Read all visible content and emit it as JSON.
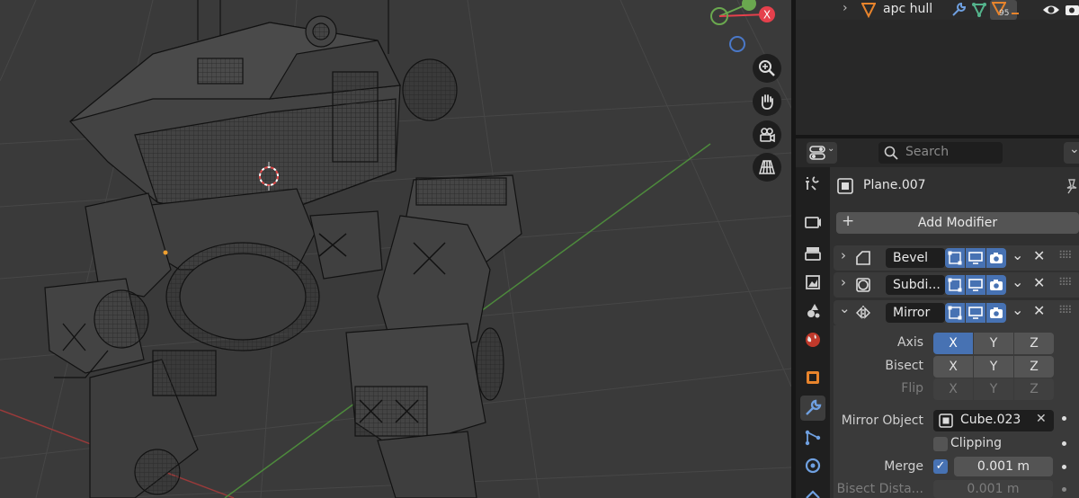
{
  "outliner": {
    "item_label": "apc hull",
    "badge_count": "95"
  },
  "properties": {
    "search_placeholder": "Search",
    "object_name": "Plane.007",
    "add_modifier_label": "Add Modifier",
    "modifiers": [
      {
        "name": "Bevel",
        "expanded": false
      },
      {
        "name": "Subdi...",
        "expanded": false
      },
      {
        "name": "Mirror",
        "expanded": true
      }
    ],
    "mirror": {
      "axis_label": "Axis",
      "bisect_label": "Bisect",
      "flip_label": "Flip",
      "axes": [
        "X",
        "Y",
        "Z"
      ],
      "mirror_object_label": "Mirror Object",
      "mirror_object_value": "Cube.023",
      "clipping_label": "Clipping",
      "merge_label": "Merge",
      "merge_value": "0.001 m",
      "bisect_distance_label": "Bisect Dista...",
      "bisect_distance_value": "0.001 m"
    }
  },
  "colors": {
    "accent": "#4772b3",
    "viewport_bg": "#3a3a3a",
    "panel_bg": "#303030",
    "axis_x": "#e5404c",
    "axis_y": "#6aa84f",
    "axis_z": "#4a78c8"
  },
  "icons": {
    "nav": [
      "zoom-icon",
      "hand-pan-icon",
      "camera-view-icon",
      "grid-perspective-icon"
    ],
    "tabs": [
      "tool-icon",
      "render-icon",
      "output-icon",
      "view-layer-icon",
      "scene-icon",
      "world-icon",
      "object-icon",
      "modifier-icon",
      "particles-icon",
      "physics-icon",
      "constraints-icon"
    ]
  }
}
